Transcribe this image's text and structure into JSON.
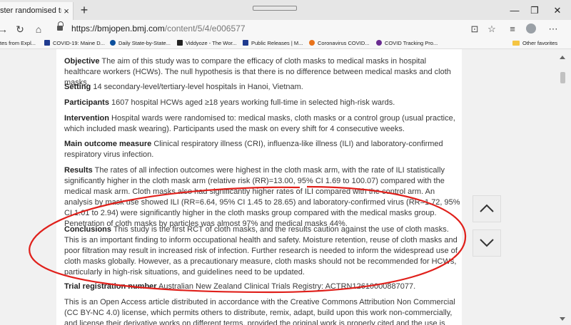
{
  "browser": {
    "tab_title": "ster randomised trial of clo",
    "tab_close": "×",
    "new_tab": "+",
    "url_host": "https://bmjopen.bmj.com",
    "url_path": "/content/5/4/e006577",
    "window_controls": {
      "minimize": "—",
      "maximize": "❐",
      "close": "✕"
    },
    "favorites": [
      {
        "label": "tes from Expl...",
        "icon_color": ""
      },
      {
        "label": "COVID-19: Maine D...",
        "icon_color": "#1f3b8f"
      },
      {
        "label": "Daily State-by-State...",
        "icon_color": "#0b4f9c"
      },
      {
        "label": "Viddyoze - The Wor...",
        "icon_color": "#222222"
      },
      {
        "label": "Public Releases | M...",
        "icon_color": "#1f3b8f"
      },
      {
        "label": "Coronavirus COVID...",
        "icon_color": "#e8731b"
      },
      {
        "label": "COVID Tracking Pro...",
        "icon_color": "#6a2c91"
      }
    ],
    "other_favorites": "Other favorites"
  },
  "article": {
    "objective": {
      "label": "Objective",
      "text": " The aim of this study was to compare the efficacy of cloth masks to medical masks in hospital healthcare workers (HCWs). The null hypothesis is that there is no difference between medical masks and cloth masks."
    },
    "setting": {
      "label": "Setting",
      "text": " 14 secondary-level/tertiary-level hospitals in Hanoi, Vietnam."
    },
    "participants": {
      "label": "Participants",
      "text": " 1607 hospital HCWs aged ≥18 years working full-time in selected high-risk wards."
    },
    "intervention": {
      "label": "Intervention",
      "text": " Hospital wards were randomised to: medical masks, cloth masks or a control group (usual practice, which included mask wearing). Participants used the mask on every shift for 4 consecutive weeks."
    },
    "main_outcome": {
      "label": "Main outcome measure",
      "text": " Clinical respiratory illness (CRI), influenza-like illness (ILI) and laboratory-confirmed respiratory virus infection."
    },
    "results": {
      "label": "Results",
      "text": " The rates of all infection outcomes were highest in the cloth mask arm, with the rate of ILI statistically significantly higher in the cloth mask arm (relative risk (RR)=13.00, 95% CI 1.69 to 100.07) compared with the medical mask arm. Cloth masks also had significantly higher rates of ILI compared with the control arm. An analysis by mask use showed ILI (RR=6.64, 95% CI 1.45 to 28.65) and laboratory-confirmed virus (RR=1.72, 95% CI 1.01 to 2.94) were significantly higher in the cloth masks group compared with the medical masks group. Penetration of cloth masks by particles was almost 97% and medical masks 44%."
    },
    "conclusions": {
      "label": "Conclusions",
      "text": " This study is the first RCT of cloth masks, and the results caution against the use of cloth masks. This is an important finding to inform occupational health and safety. Moisture retention, reuse of cloth masks and poor filtration may result in increased risk of infection. Further research is needed to inform the widespread use of cloth masks globally. However, as a precautionary measure, cloth masks should not be recommended for HCWs, particularly in high-risk situations, and guidelines need to be updated."
    },
    "trial_registration": {
      "label": "Trial registration number",
      "text": " Australian New Zealand Clinical Trials Registry: ACTRN12610000887077."
    },
    "license": {
      "text": "This is an Open Access article distributed in accordance with the Creative Commons Attribution Non Commercial (CC BY-NC 4.0) license, which permits others to distribute, remix, adapt, build upon this work non-commercially, and license their derivative works on different terms, provided the original work is properly cited and the use is non-commercial."
    }
  },
  "colors": {
    "annotation": "#e0201b",
    "accent": "#0b4f9c"
  }
}
